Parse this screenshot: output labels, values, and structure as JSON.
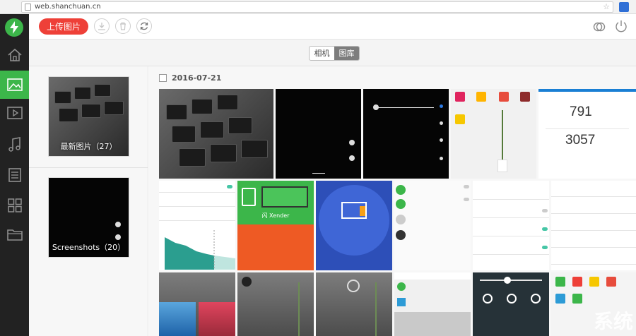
{
  "browser": {
    "url": "web.shanchuan.cn"
  },
  "toolbar": {
    "upload_label": "上传图片",
    "icons": [
      "download-icon",
      "trash-icon",
      "refresh-icon",
      "link-icon",
      "power-icon"
    ]
  },
  "sidebar": {
    "logo": "lightning-icon",
    "items": [
      {
        "name": "home",
        "icon": "home-icon"
      },
      {
        "name": "photos",
        "icon": "image-icon",
        "active": true
      },
      {
        "name": "video",
        "icon": "video-icon"
      },
      {
        "name": "music",
        "icon": "music-icon"
      },
      {
        "name": "contacts",
        "icon": "contacts-icon"
      },
      {
        "name": "apps",
        "icon": "apps-icon"
      },
      {
        "name": "files",
        "icon": "folder-icon"
      }
    ]
  },
  "tabs": [
    {
      "label": "相机",
      "active": false
    },
    {
      "label": "图库",
      "active": true
    }
  ],
  "albums": [
    {
      "label": "最新图片（27）"
    },
    {
      "label": "Screenshots（20）"
    }
  ],
  "photos": {
    "date": "2016-07-21",
    "thumbs": {
      "score_top": "791",
      "score_bottom": "3057",
      "xender_label": "闪 Xender",
      "watermark": "系统"
    }
  },
  "colors": {
    "accent_green": "#3cb64a",
    "upload_red": "#ee4038",
    "sidebar_dark": "#222222"
  }
}
